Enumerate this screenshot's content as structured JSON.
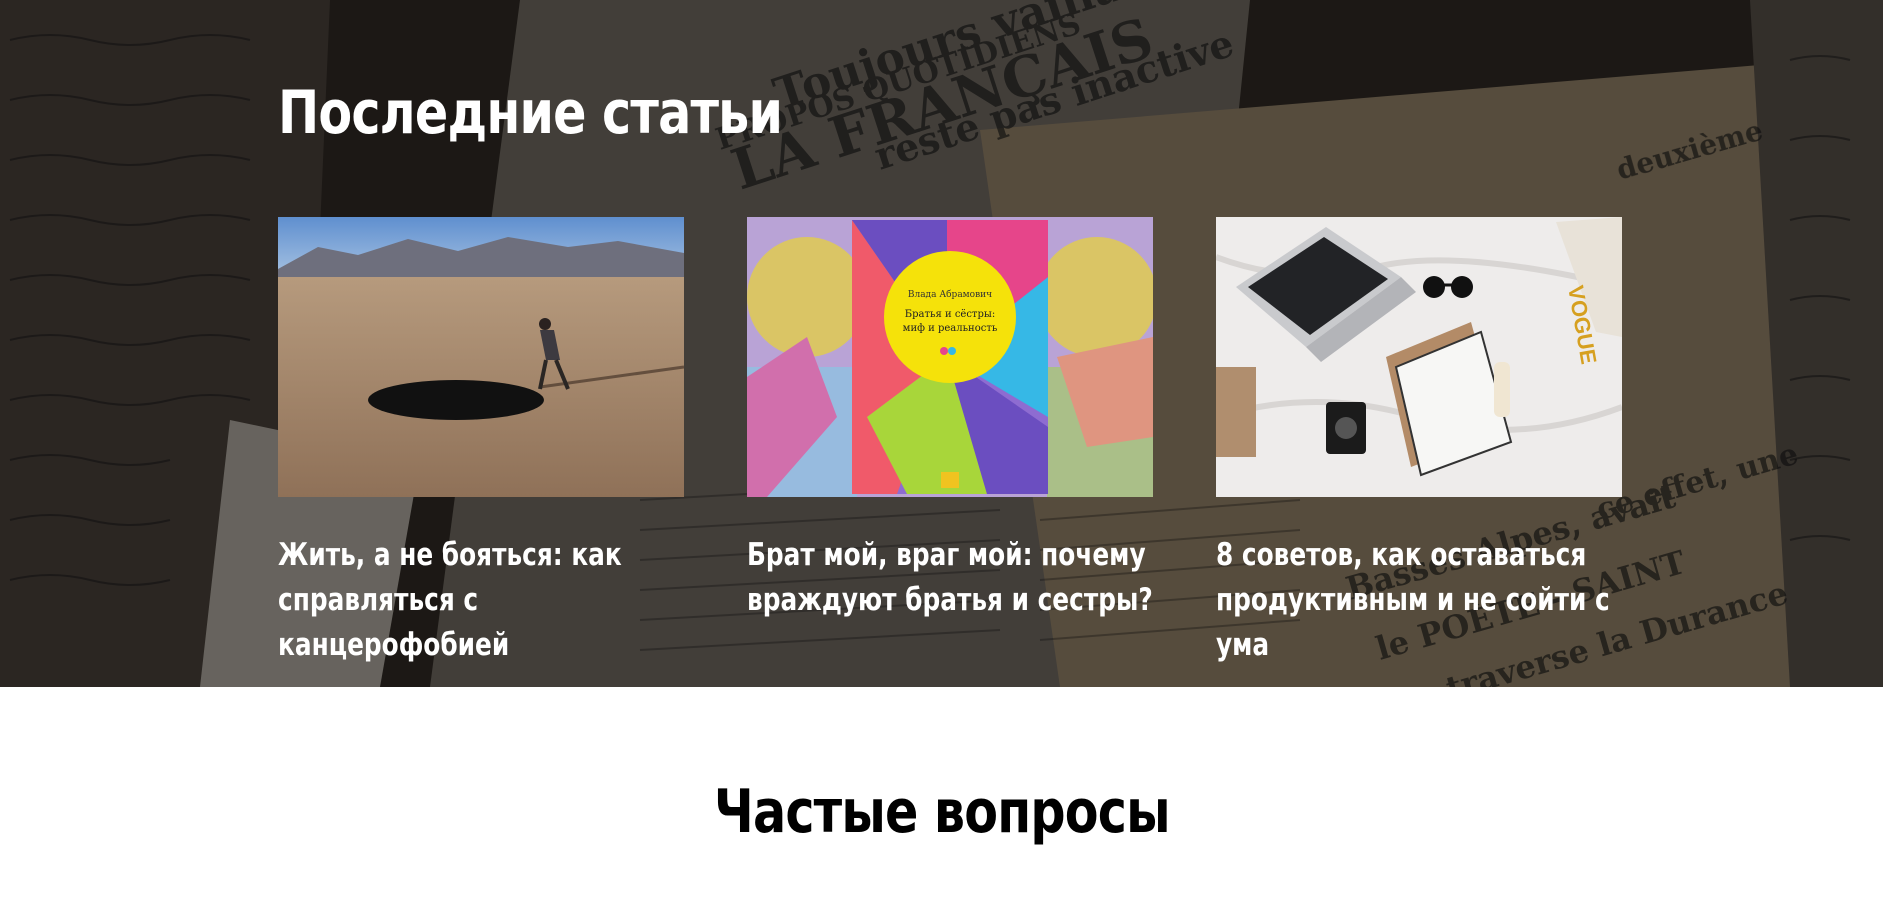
{
  "latest": {
    "title": "Последние статьи",
    "articles": [
      {
        "title": "Жить, а не бояться: как справляться с канцерофобией",
        "image": "desert-hole-photo"
      },
      {
        "title": "Брат мой, враг мой: почему враждуют братья и сестры?",
        "image": "book-cover-photo",
        "cover_author": "Влада Абрамович",
        "cover_title": "Братья и сёстры: миф и реальность"
      },
      {
        "title": "8 советов, как оставаться продуктивным и не сойти с ума",
        "image": "laptop-desk-photo"
      }
    ]
  },
  "faq": {
    "title": "Частые вопросы"
  },
  "background": {
    "newspaper_words": [
      "LA FRANÇAIS",
      "Toujours vaillants",
      "PROPOS QUOTIDIENS",
      "reste pas inactive",
      "deuxième",
      "Basses Alpes, avait",
      "le POÈTE - SAINT",
      "traverse la Durance",
      "ce effet, une"
    ]
  }
}
